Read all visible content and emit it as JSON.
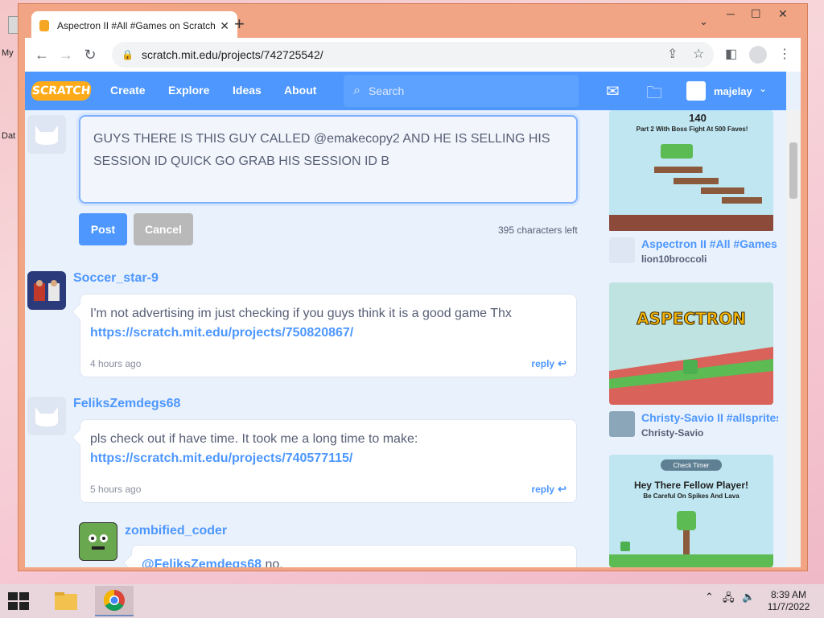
{
  "desktop": {
    "label_my": "My",
    "label_dat": "Dat"
  },
  "browser": {
    "tab_title": "Aspectron II #All #Games on Scratch",
    "tab_close": "✕",
    "new_tab": "+",
    "url": "scratch.mit.edu/projects/742725542/",
    "min": "─",
    "max": "☐",
    "close": "✕",
    "tab_list": "⌄"
  },
  "scratch_nav": {
    "logo": "SCRATCH",
    "links": [
      "Create",
      "Explore",
      "Ideas",
      "About"
    ],
    "search_placeholder": "Search",
    "username": "majelay"
  },
  "compose": {
    "text": "GUYS THERE IS THIS GUY CALLED @emakecopy2 AND HE IS SELLING HIS SESSION ID QUICK GO GRAB HIS SESSION ID B",
    "post_label": "Post",
    "cancel_label": "Cancel",
    "chars_left": "395 characters left"
  },
  "comments": [
    {
      "user": "Soccer_star-9",
      "text": "I'm not advertising im just checking if you guys think it is a good game Thx",
      "link": "https://scratch.mit.edu/projects/750820867/",
      "time": "4 hours ago",
      "reply": "reply"
    },
    {
      "user": "FeliksZemdegs68",
      "text": "pls check out if have time. It took me a long time to make:",
      "link": "https://scratch.mit.edu/projects/740577115/",
      "time": "5 hours ago",
      "reply": "reply"
    },
    {
      "user": "zombified_coder",
      "mention": "@FeliksZemdegs68",
      "text": " no."
    }
  ],
  "sidebar_projects": [
    {
      "thumb_top_text": "140",
      "thumb_sub_text": "Part 2 With Boss Fight At 500 Faves!",
      "title": "Aspectron II #All #Games",
      "author": "lion10broccoli"
    },
    {
      "thumb_top_text": "ASPECTRON",
      "title": "Christy-Savio II #allsprites",
      "author": "Christy-Savio"
    },
    {
      "thumb_badge": "Check Timer",
      "thumb_top_text": "Hey There Fellow Player!",
      "thumb_sub_text": "Be Careful On Spikes And Lava"
    }
  ],
  "taskbar": {
    "time": "8:39 AM",
    "date": "11/7/2022"
  }
}
